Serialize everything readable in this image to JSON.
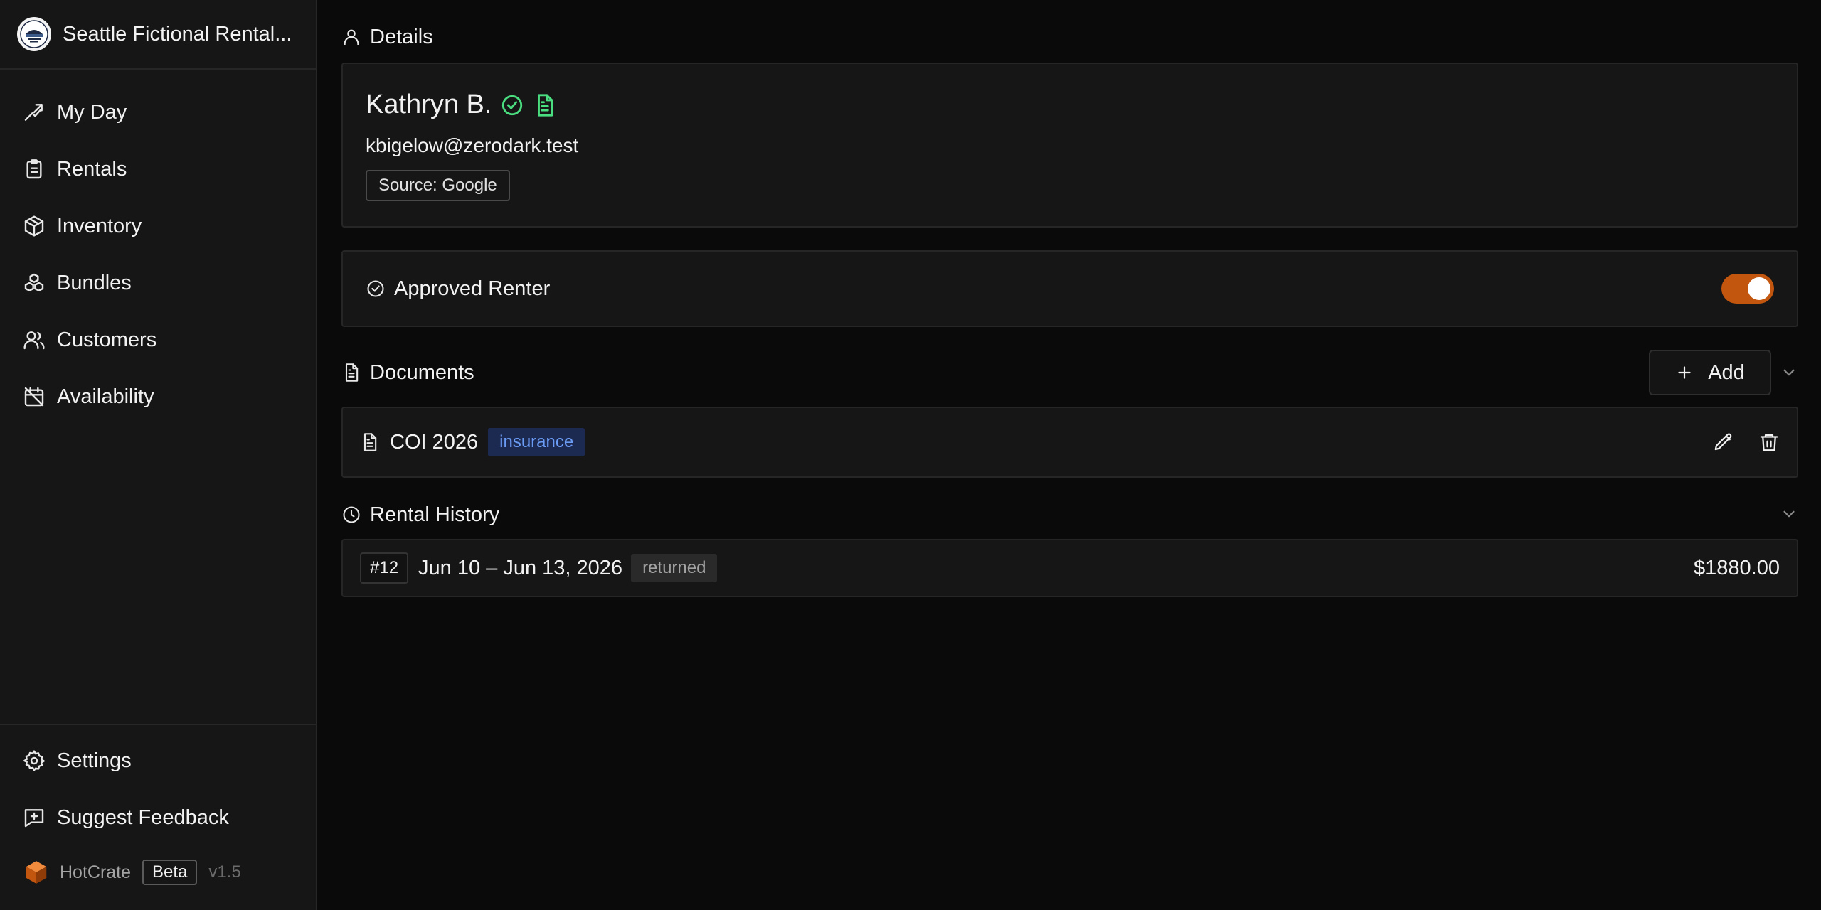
{
  "org": {
    "name": "Seattle Fictional Rental..."
  },
  "nav": {
    "items": [
      {
        "label": "My Day",
        "icon": "trending-arrow-icon"
      },
      {
        "label": "Rentals",
        "icon": "clipboard-icon"
      },
      {
        "label": "Inventory",
        "icon": "package-icon"
      },
      {
        "label": "Bundles",
        "icon": "boxes-icon"
      },
      {
        "label": "Customers",
        "icon": "users-icon"
      },
      {
        "label": "Availability",
        "icon": "calendar-off-icon"
      }
    ],
    "bottom": [
      {
        "label": "Settings",
        "icon": "gear-icon"
      },
      {
        "label": "Suggest Feedback",
        "icon": "message-plus-icon"
      }
    ]
  },
  "product": {
    "name": "HotCrate",
    "badge": "Beta",
    "version": "v1.5"
  },
  "details": {
    "section_title": "Details",
    "customer_name": "Kathryn B.",
    "email": "kbigelow@zerodark.test",
    "source": "Source: Google"
  },
  "approved": {
    "label": "Approved Renter",
    "on": true
  },
  "documents": {
    "section_title": "Documents",
    "add_label": "Add",
    "items": [
      {
        "name": "COI 2026",
        "tag": "insurance"
      }
    ]
  },
  "history": {
    "section_title": "Rental History",
    "rows": [
      {
        "order": "#12",
        "dates": "Jun 10 – Jun 13, 2026",
        "status": "returned",
        "total": "$1880.00"
      }
    ]
  },
  "colors": {
    "accent": "#c2560e",
    "success": "#4ade80",
    "tag_blue": "#6b9cf5",
    "background": "#0a0a0a",
    "card": "#161616"
  }
}
